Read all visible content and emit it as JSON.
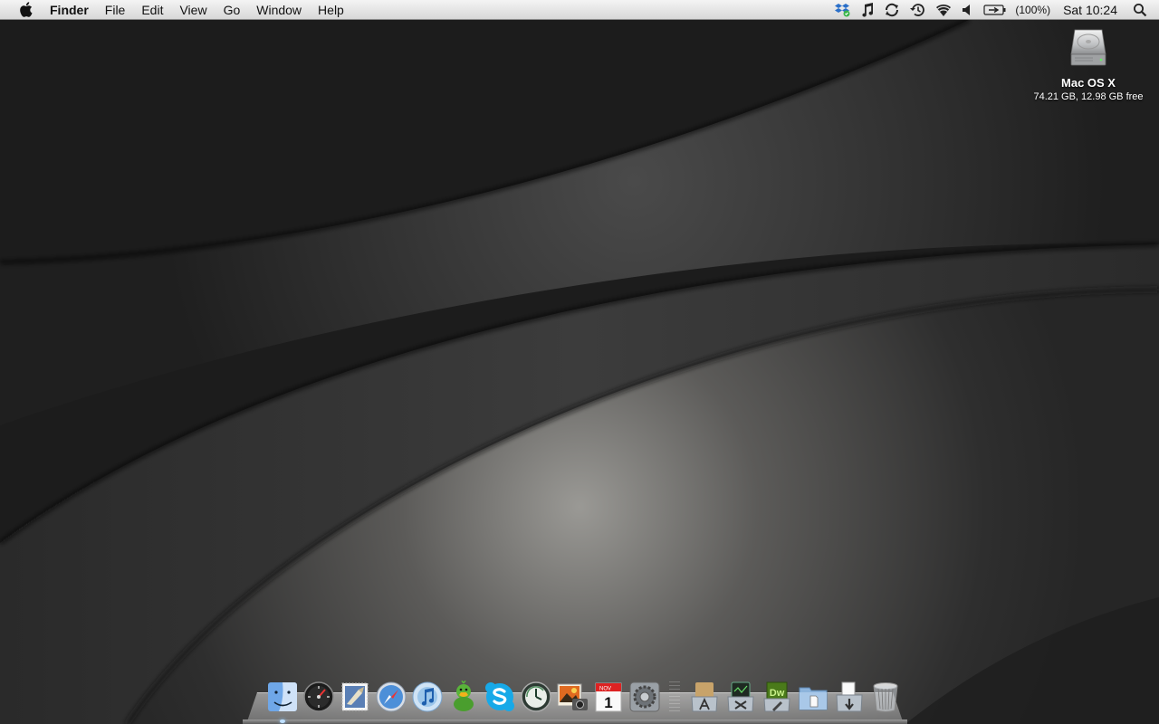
{
  "menubar": {
    "app_name": "Finder",
    "menus": [
      "File",
      "Edit",
      "View",
      "Go",
      "Window",
      "Help"
    ],
    "status_icons": [
      "dropbox-icon",
      "itunes-note-icon",
      "sync-icon",
      "time-machine-icon",
      "wifi-icon",
      "volume-icon",
      "battery-icon"
    ],
    "battery_text": "(100%)",
    "clock": "Sat 10:24",
    "spotlight_icon": "magnifier-icon"
  },
  "desktop": {
    "drive": {
      "name": "Mac OS X",
      "info": "74.21 GB, 12.98 GB free",
      "icon": "hard-drive-icon"
    }
  },
  "dock": {
    "apps": [
      "finder",
      "dashboard",
      "mail",
      "safari",
      "itunes",
      "adium",
      "skype",
      "time-machine",
      "iphoto",
      "ical",
      "system-preferences"
    ],
    "calendar_month": "NOV",
    "calendar_day": "1",
    "stacks": [
      "applications-stack",
      "utilities-stack",
      "dreamweaver-stack",
      "documents-stack",
      "downloads-stack",
      "trash"
    ],
    "dreamweaver_label": "Dw"
  },
  "colors": {
    "wallpaper_dark": "#1a1a1a",
    "wallpaper_light": "#8a8985",
    "menubar": "#e6e6e6"
  }
}
